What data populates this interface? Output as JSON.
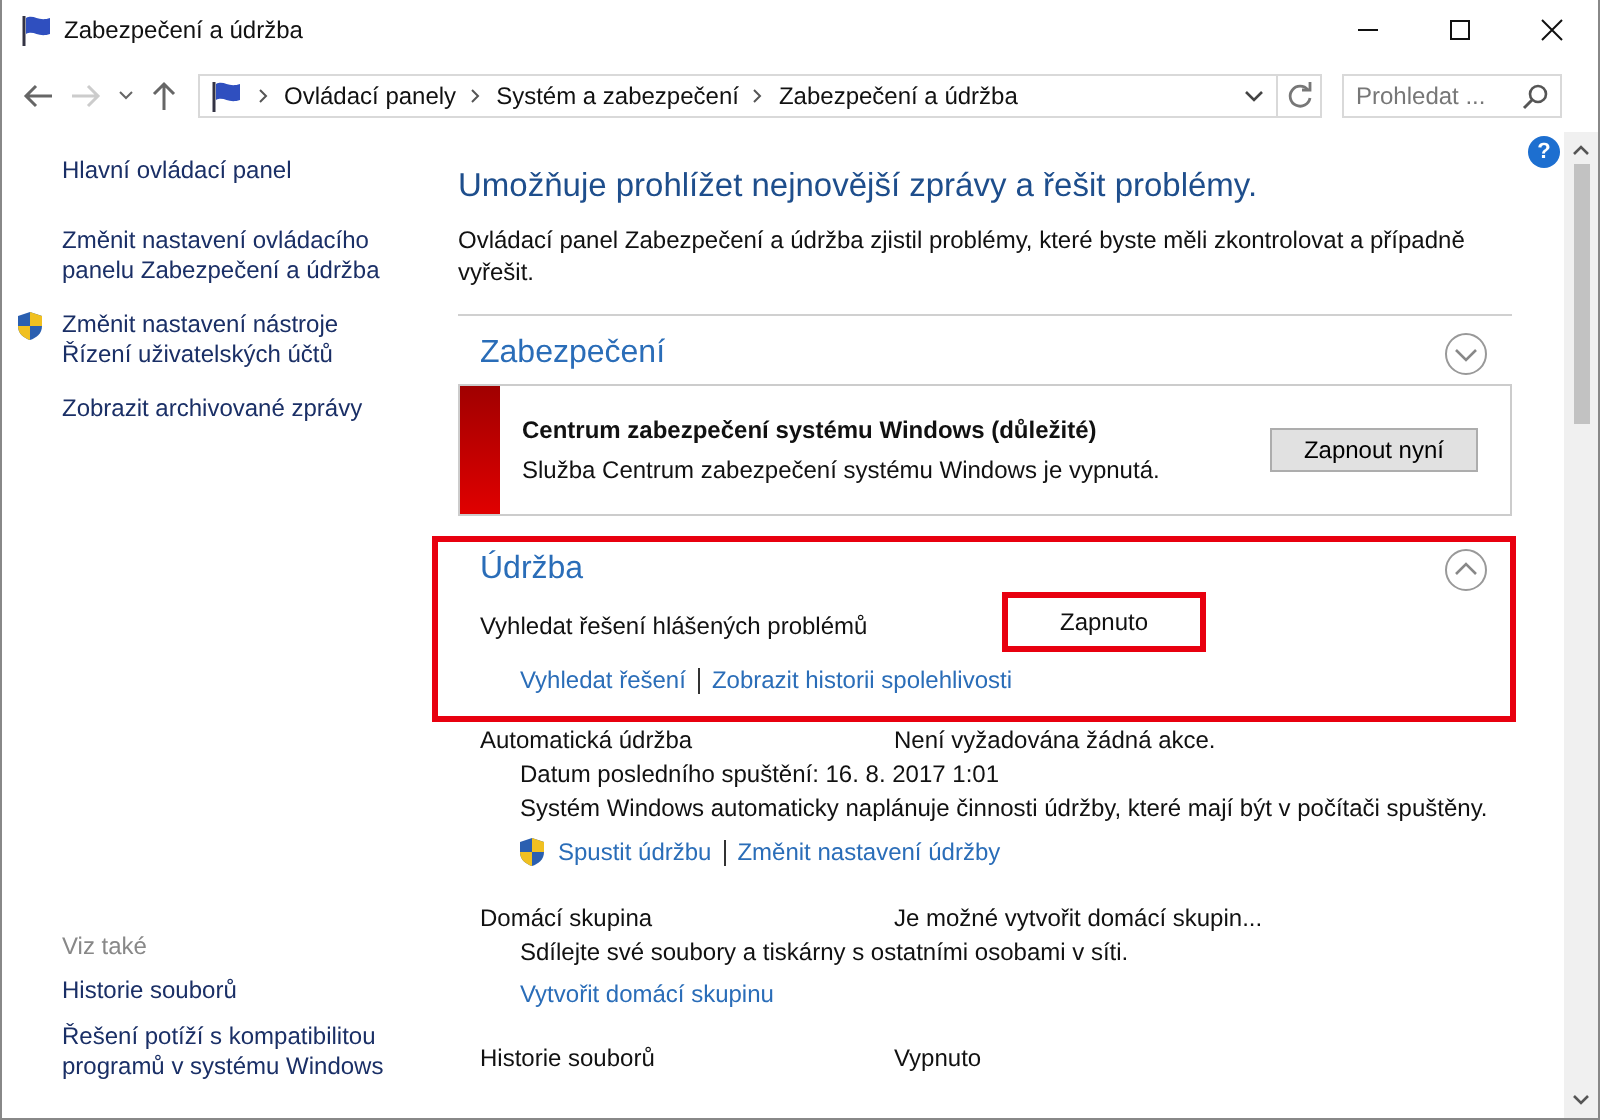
{
  "window": {
    "title": "Zabezpečení a údržba"
  },
  "address": {
    "breadcrumbs": [
      "Ovládací panely",
      "Systém a zabezpečení",
      "Zabezpečení a údržba"
    ],
    "search_placeholder": "Prohledat ..."
  },
  "help": "?",
  "sidebar": {
    "links": [
      {
        "text": "Hlavní ovládací panel"
      },
      {
        "text": "Změnit nastavení ovládacího panelu Zabezpečení a údržba"
      },
      {
        "text": "Změnit nastavení nástroje Řízení uživatelských účtů",
        "shield": true
      },
      {
        "text": "Zobrazit archivované zprávy"
      }
    ],
    "see_also": {
      "heading": "Viz také",
      "links": [
        "Historie souborů",
        "Řešení potíží s kompatibilitou programů v systému Windows"
      ]
    }
  },
  "main": {
    "heading": "Umožňuje prohlížet nejnovější zprávy a řešit problémy.",
    "description": "Ovládací panel Zabezpečení a údržba zjistil problémy, které byste měli zkontrolovat a případně vyřešit.",
    "sections": [
      {
        "title": "Zabezpečení",
        "expanded": false,
        "alerts": [
          {
            "title": "Centrum zabezpečení systému Windows  (důležité)",
            "text": "Služba Centrum zabezpečení systému Windows je vypnutá.",
            "button": "Zapnout nyní"
          }
        ]
      },
      {
        "title": "Údržba",
        "expanded": true,
        "highlighted": true,
        "items": [
          {
            "label": "Vyhledat řešení hlášených problémů",
            "value": "Zapnuto",
            "value_highlighted": true,
            "links": [
              "Vyhledat řešení",
              "Zobrazit historii spolehlivosti"
            ]
          }
        ]
      }
    ],
    "items": [
      {
        "label": "Automatická údržba",
        "value": "Není vyžadována žádná akce.",
        "details": [
          "Datum posledního spuštění: 16. 8. 2017 1:01",
          "Systém Windows automaticky naplánuje činnosti údržby, které mají být v počítači spuštěny."
        ],
        "shield": true,
        "links": [
          "Spustit údržbu",
          "Změnit nastavení údržby"
        ]
      },
      {
        "label": "Domácí skupina",
        "value": "Je možné vytvořit domácí skupin...",
        "details": [
          "Sdílejte své soubory a tiskárny s ostatními osobami v síti."
        ],
        "links": [
          "Vytvořit domácí skupinu"
        ]
      },
      {
        "label": "Historie souborů",
        "value": "Vypnuto"
      }
    ]
  }
}
